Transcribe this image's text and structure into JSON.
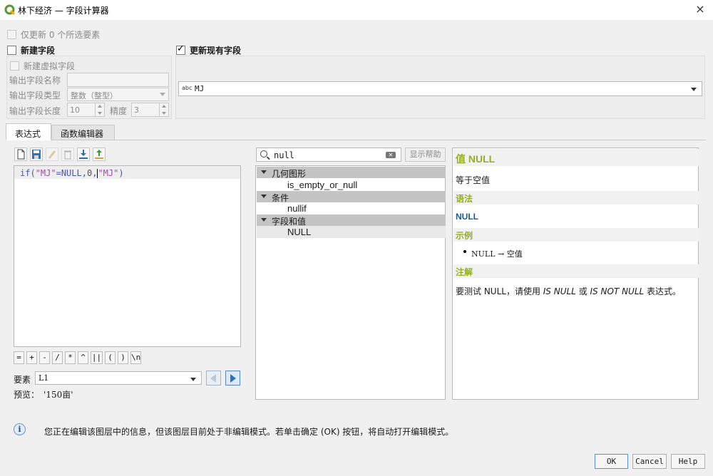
{
  "window": {
    "title": "林下经济 — 字段计算器",
    "close_label": "×"
  },
  "top_options": {
    "update_selected_label": "仅更新 0 个所选要素",
    "new_field_label": "新建字段",
    "update_existing_label": "更新现有字段",
    "virtual_field_label": "新建虚拟字段",
    "output_field_name_label": "输出字段名称",
    "output_field_type_label": "输出字段类型",
    "output_field_type_value": "整数（整型）",
    "output_field_length_label": "输出字段长度",
    "output_field_length_value": "10",
    "precision_label": "精度",
    "precision_value": "3",
    "existing_field_type_badge": "abc",
    "existing_field_value": "MJ"
  },
  "tabs": [
    {
      "label": "表达式",
      "active": true
    },
    {
      "label": "函数编辑器",
      "active": false
    }
  ],
  "toolbar_icons": [
    "new-file-icon",
    "save-icon",
    "edit-icon",
    "delete-icon",
    "import-icon",
    "export-icon"
  ],
  "expression": {
    "kw": "if",
    "open": "(",
    "field1": "\"MJ\"",
    "eq": "=",
    "null": "NULL",
    "comma1": ",",
    "zero": "0",
    "comma2": ",",
    "field2": "\"MJ\"",
    "close": ")"
  },
  "operators": [
    "=",
    "+",
    "-",
    "/",
    "*",
    "^",
    "||",
    "(",
    ")",
    "\\n"
  ],
  "feature": {
    "label": "要素",
    "value": "L1",
    "preview_label": "预览：",
    "preview_value": "'150亩'"
  },
  "search": {
    "value": "null",
    "help_button": "显示帮助"
  },
  "function_tree": [
    {
      "group": "几何图形",
      "items": [
        "is_empty_or_null"
      ]
    },
    {
      "group": "条件",
      "items": [
        "nullif"
      ]
    },
    {
      "group": "字段和值",
      "items": [
        "NULL"
      ]
    }
  ],
  "help": {
    "title": "值 NULL",
    "description": "等于空值",
    "syntax_header": "语法",
    "syntax": "NULL",
    "examples_header": "示例",
    "example": "NULL → 空值",
    "notes_header": "注解",
    "note_prefix": "要测试 NULL，请使用 ",
    "note_is_null": "IS NULL",
    "note_or": " 或 ",
    "note_is_not_null": "IS NOT NULL",
    "note_suffix": " 表达式。"
  },
  "info_message": "您正在编辑该图层中的信息，但该图层目前处于非编辑模式。若单击确定 (OK) 按钮，将自动打开编辑模式。",
  "buttons": {
    "ok": "OK",
    "cancel": "Cancel",
    "help": "Help"
  },
  "colors": {
    "help_accent": "#93b023",
    "syntax_blue": "#1d5c8c",
    "tree_group_bg": "#c4c4c4"
  }
}
